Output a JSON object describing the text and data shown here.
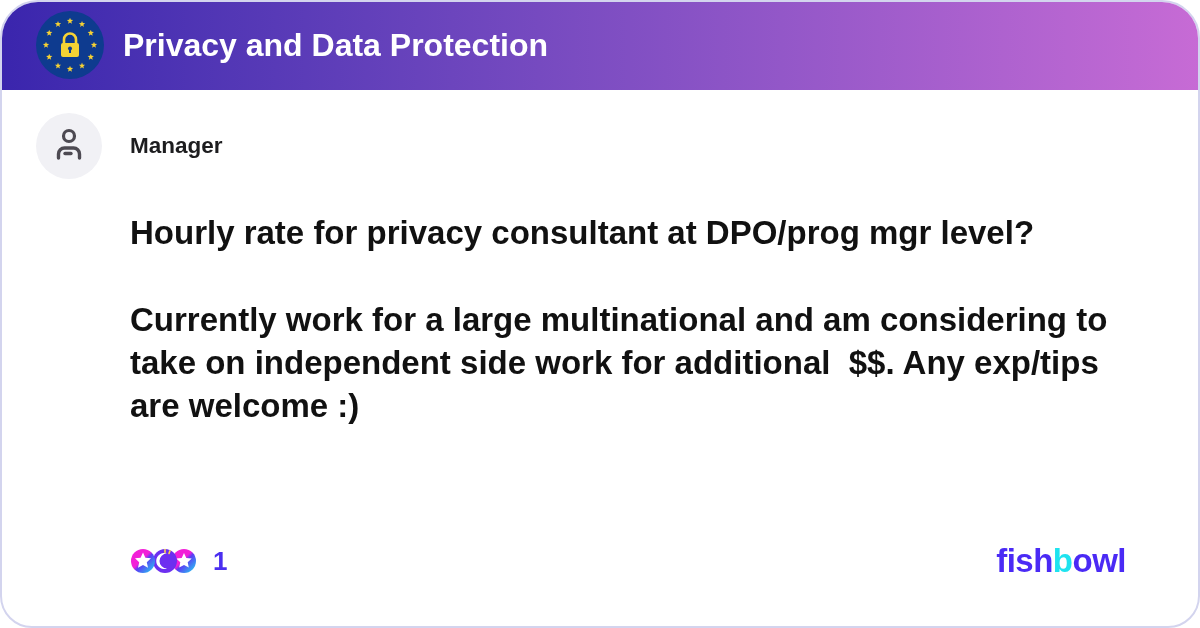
{
  "header": {
    "title": "Privacy and Data Protection"
  },
  "post": {
    "author": "Manager",
    "title": "Hourly rate for privacy consultant at DPO/prog mgr level?",
    "body": "Currently work for a large multinational and am considering to take on independent side work for additional  $$. Any exp/tips are welcome :)"
  },
  "footer": {
    "reaction_count": "1",
    "brand": "fishbowl"
  }
}
